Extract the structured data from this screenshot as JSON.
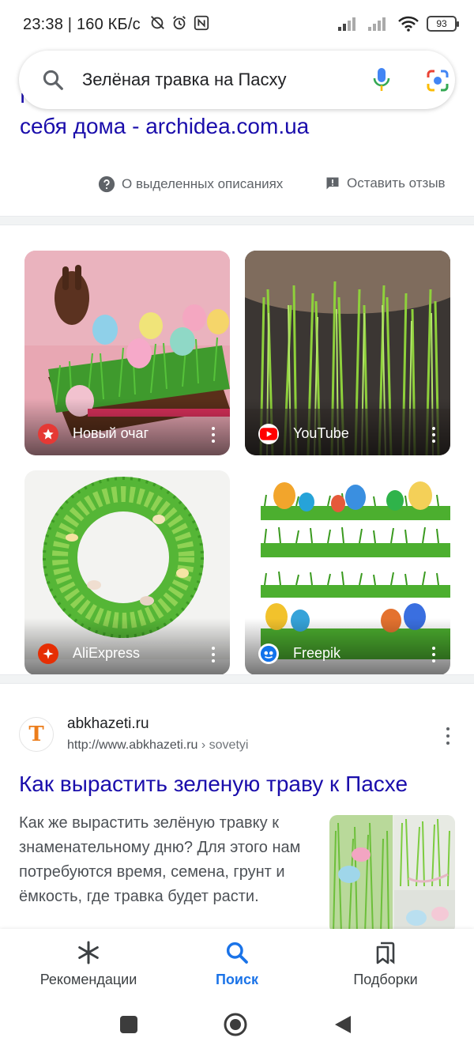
{
  "status_bar": {
    "time": "23:38 | 160 КБ/с",
    "battery": "93"
  },
  "search": {
    "query": "Зелёная травка на Пасху"
  },
  "previous_result": {
    "title_line1": "Как вырастить пасхальную траву у",
    "title_line2": "себя дома - archidea.com.ua"
  },
  "feedback": {
    "about_label": "О выделенных описаниях",
    "feedback_label": "Оставить отзыв"
  },
  "image_results": [
    {
      "source": "Новый очаг",
      "icon": "star-badge-icon",
      "color": "#e53935"
    },
    {
      "source": "YouTube",
      "icon": "youtube-play-icon",
      "color": "#ff0000"
    },
    {
      "source": "AliExpress",
      "icon": "aliexpress-icon",
      "color": "#e62e04"
    },
    {
      "source": "Freepik",
      "icon": "freepik-icon",
      "color": "#1273eb"
    }
  ],
  "result": {
    "site_name": "abkhazeti.ru",
    "url": "http://www.abkhazeti.ru",
    "breadcrumb": " › sovetyi",
    "logo_letter": "T",
    "title": "Как вырастить зеленую траву к Пасхе",
    "snippet": "Как же вырастить зелёную травку к знаменательному дню? Для этого нам потребуются время, семена, грунт и ёмкость, где травка будет расти."
  },
  "bottom_nav": {
    "items": [
      {
        "label": "Рекомендации",
        "icon": "asterisk-icon",
        "active": false
      },
      {
        "label": "Поиск",
        "icon": "search-icon",
        "active": true
      },
      {
        "label": "Подборки",
        "icon": "collections-icon",
        "active": false
      }
    ]
  },
  "colors": {
    "link": "#1a0dab",
    "accent": "#1a73e8",
    "text_secondary": "#5f6368"
  }
}
